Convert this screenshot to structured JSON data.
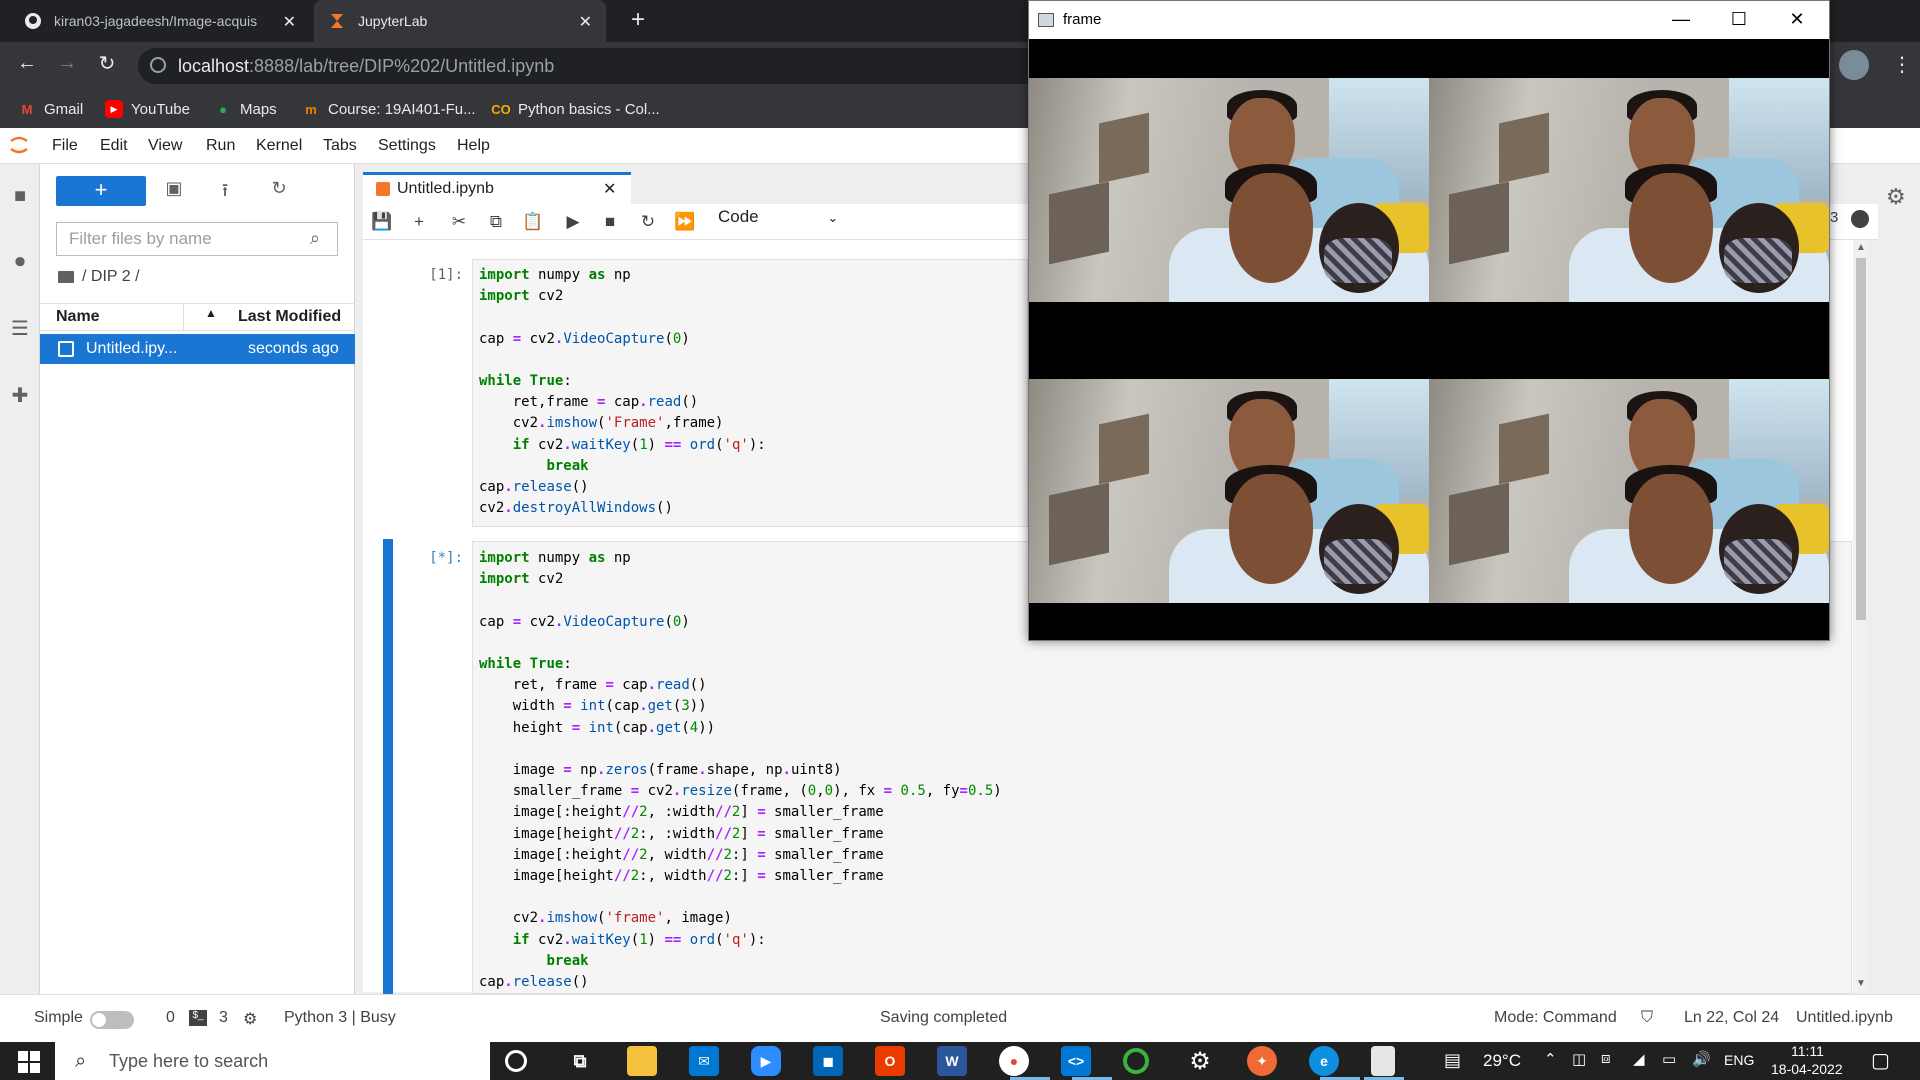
{
  "browser": {
    "tabs": [
      {
        "title": "kiran03-jagadeesh/Image-acquis",
        "icon": "github-icon"
      },
      {
        "title": "JupyterLab",
        "icon": "jupyter-icon"
      }
    ],
    "url_host": "localhost",
    "url_path": ":8888/lab/tree/DIP%202/Untitled.ipynb",
    "bookmarks": [
      {
        "label": "Gmail",
        "icon": "gmail-icon",
        "color": "#ea4335"
      },
      {
        "label": "YouTube",
        "icon": "youtube-icon",
        "color": "#ff0000"
      },
      {
        "label": "Maps",
        "icon": "maps-icon",
        "color": "#34a853"
      },
      {
        "label": "Course: 19AI401-Fu...",
        "icon": "course-icon",
        "color": "#f57c00"
      },
      {
        "label": "Python basics - Col...",
        "icon": "colab-icon",
        "color": "#f9ab00"
      }
    ]
  },
  "jupyter": {
    "menu": [
      "File",
      "Edit",
      "View",
      "Run",
      "Kernel",
      "Tabs",
      "Settings",
      "Help"
    ],
    "filter_placeholder": "Filter files by name",
    "breadcrumb": "/ DIP 2 /",
    "columns": {
      "name": "Name",
      "modified": "Last Modified"
    },
    "file": {
      "name": "Untitled.ipy...",
      "modified": "seconds ago"
    },
    "notebook_tab": "Untitled.ipynb",
    "cell_type": "Code",
    "cell1_prompt": "[1]:",
    "cell2_prompt": "[*]:",
    "kernel_count_fragment": "3"
  },
  "status": {
    "mode_label": "Simple",
    "terminals": "0",
    "kernels": "3",
    "kernel": "Python 3 | Busy",
    "message": "Saving completed",
    "mode": "Mode: Command",
    "cursor": "Ln 22, Col 24",
    "file": "Untitled.ipynb"
  },
  "opencv_window": {
    "title": "frame"
  },
  "taskbar": {
    "search_placeholder": "Type here to search",
    "temperature": "29°C",
    "language": "ENG",
    "time": "11:11",
    "date": "18-04-2022"
  }
}
